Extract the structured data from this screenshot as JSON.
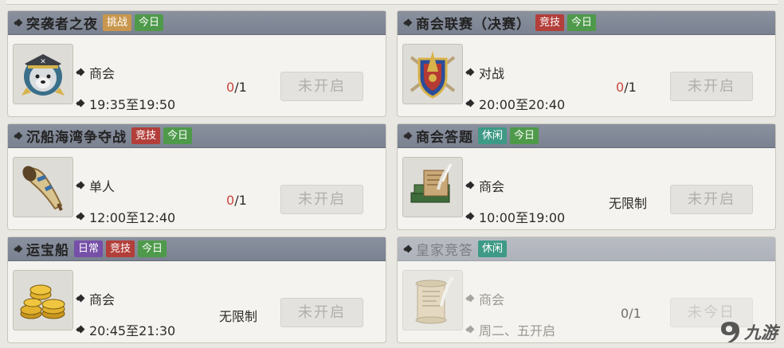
{
  "cards": [
    {
      "title": "突袭者之夜",
      "tags": [
        "挑战",
        "今日"
      ],
      "icon": "wolf-pirate-emblem-icon",
      "line1": "商会",
      "line2": "19:35至19:50",
      "progress_done": "0",
      "progress_total": "/1",
      "button": "未开启"
    },
    {
      "title": "商会联赛（决赛）",
      "tags": [
        "竞技",
        "今日"
      ],
      "icon": "shield-swords-emblem-icon",
      "line1": "对战",
      "line2": "20:00至20:40",
      "progress_done": "0",
      "progress_total": "/1",
      "button": "未开启"
    },
    {
      "title": "沉船海湾争夺战",
      "tags": [
        "竞技",
        "今日"
      ],
      "icon": "horn-icon",
      "line1": "单人",
      "line2": "12:00至12:40",
      "progress_done": "0",
      "progress_total": "/1",
      "button": "未开启"
    },
    {
      "title": "商会答题",
      "tags": [
        "休闲",
        "今日"
      ],
      "icon": "books-quill-icon",
      "line1": "商会",
      "line2": "10:00至19:00",
      "limit": "无限制",
      "button": "未开启"
    },
    {
      "title": "运宝船",
      "tags": [
        "日常",
        "竞技",
        "今日"
      ],
      "icon": "gold-coins-icon",
      "line1": "商会",
      "line2": "20:45至21:30",
      "limit": "无限制",
      "button": "未开启"
    },
    {
      "title": "皇家竞答",
      "tags": [
        "休闲"
      ],
      "icon": "scroll-quill-icon",
      "line1": "商会",
      "line2": "周二、五开启",
      "progress_text": "0/1",
      "button": "未今日"
    }
  ],
  "watermark": {
    "text": "九游",
    "icon": "nine-game-logo-icon"
  },
  "colors": {
    "header_bg": "#7a8190",
    "tag_challenge": "#c8974d",
    "tag_compete": "#b33f3a",
    "tag_today": "#4e9a4a",
    "tag_daily": "#7650a8",
    "tag_leisure": "#3e9a86",
    "progress_done": "#c9453c"
  }
}
